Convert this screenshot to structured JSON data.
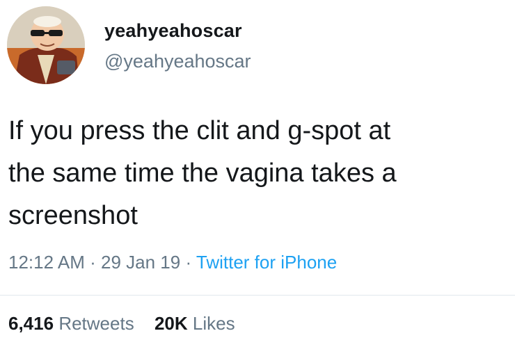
{
  "user": {
    "display_name": "yeahyeahoscar",
    "handle": "@yeahyeahoscar",
    "avatar": "cartoon-old-man-with-sunglasses-avatar"
  },
  "tweet": {
    "lines": [
      "If you press the clit and g-spot at",
      "the same time the vagina takes a",
      "screenshot"
    ],
    "time": "12:12 AM",
    "date": "29 Jan 19",
    "source": "Twitter for iPhone",
    "separator": "·"
  },
  "stats": {
    "retweets_count": "6,416",
    "retweets_label": "Retweets",
    "likes_count": "20K",
    "likes_label": "Likes"
  },
  "colors": {
    "text": "#14171a",
    "secondary": "#657786",
    "link": "#1da1f2",
    "divider": "#e1e8ed"
  }
}
